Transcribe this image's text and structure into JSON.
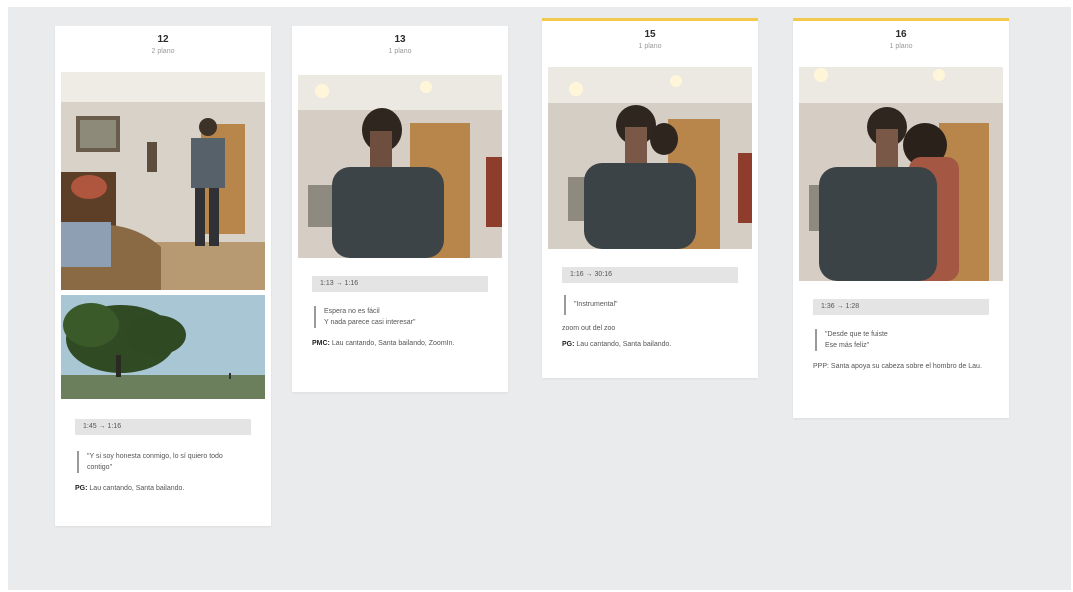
{
  "cards": [
    {
      "number": "12",
      "subtitle": "2 plano",
      "time": "1:45  →  1:16",
      "quote": "\"Y si soy honesta conmigo, lo sí quiero todo contigo\"",
      "note_label": "PG:",
      "note_text": "Lau cantando, Santa bailando."
    },
    {
      "number": "13",
      "subtitle": "1 plano",
      "time": "1:13  →  1:16",
      "quote_lines": [
        "Espera no es fácil",
        "Y nada parece casi interesar\""
      ],
      "note_label": "PMC:",
      "note_text": "Lau cantando, Santa bailando, ZoomIn."
    },
    {
      "number": "15",
      "subtitle": "1 plano",
      "time": "1:16  →  30:16",
      "quote": "\"Instrumental\"",
      "extra": "zoom out del zoo",
      "note_label": "PG:",
      "note_text": "Lau cantando, Santa bailando."
    },
    {
      "number": "16",
      "subtitle": "1 plano",
      "time": "1:36  →  1:28",
      "quote_lines": [
        "\"Desde que te fuiste",
        "Ese más feliz\""
      ],
      "note_label": "",
      "note_text": "PPP: Santa apoya su cabeza sobre el hombro de Lau."
    }
  ]
}
